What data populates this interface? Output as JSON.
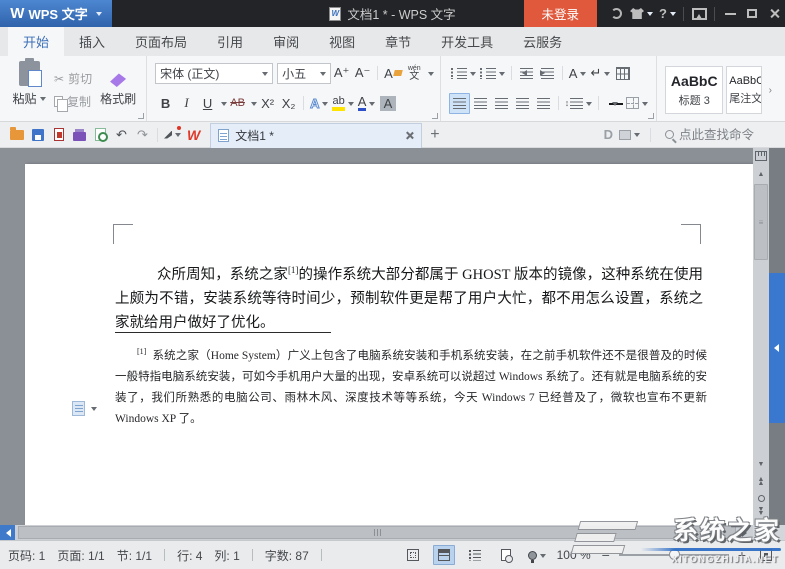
{
  "titlebar": {
    "app_button_label": "WPS 文字",
    "doc_title": "文档1 * - WPS 文字",
    "login_label": "未登录"
  },
  "menu_tabs": [
    {
      "label": "开始"
    },
    {
      "label": "插入"
    },
    {
      "label": "页面布局"
    },
    {
      "label": "引用"
    },
    {
      "label": "审阅"
    },
    {
      "label": "视图"
    },
    {
      "label": "章节"
    },
    {
      "label": "开发工具"
    },
    {
      "label": "云服务"
    }
  ],
  "ribbon": {
    "paste_label": "粘贴",
    "cut_label": "剪切",
    "copy_label": "复制",
    "format_painter_label": "格式刷",
    "font_name": "宋体 (正文)",
    "font_size": "小五",
    "grow_font": "A⁺",
    "shrink_font": "A⁻",
    "clear_a": "A",
    "phonetic_top": "wén",
    "phonetic_bottom": "文",
    "bold": "B",
    "italic": "I",
    "underline": "U",
    "strike": "AB",
    "superscript": "X²",
    "subscript": "X₂",
    "outline_a": "A",
    "highlight_ab": "ab",
    "color_a": "A",
    "shade_a": "A",
    "char_scale": "A",
    "return_glyph": "↵",
    "styles": [
      {
        "preview": "AaBbC",
        "label": "标题 3"
      },
      {
        "preview": "AaBbC",
        "label": "尾注文"
      }
    ]
  },
  "glyphs": {
    "wps_w": "W",
    "wps_w_small": "W",
    "question": "?",
    "scissors": "✂",
    "undo": "↶",
    "redo": "↷",
    "docer_d": "D",
    "style_arrow": "›",
    "up_arrow": "▲",
    "down_arrow": "▼",
    "grip": "≡",
    "updown_arrow": "↕"
  },
  "doc_tabs": {
    "active_tab": "文档1 *",
    "search_placeholder": "点此查找命令"
  },
  "document": {
    "para_before_ref": "众所周知，系统之家",
    "para_ref": "[1]",
    "para_after_ref": "的操作系统大部分都属于 GHOST 版本的镜像，这种系统在使用上颇为不错，安装系统等待时间少，预制软件更是帮了用户大忙，都不用怎么设置，系统之家就给用户做好了优化。",
    "footnote_ref": "[1]",
    "footnote_text": "系统之家（Home System）广义上包含了电脑系统安装和手机系统安装，在之前手机软件还不是很普及的时候一般特指电脑系统安装，可如今手机用户大量的出现，安卓系统可以说超过 Windows 系统了。还有就是电脑系统的安装了，我们所熟悉的电脑公司、雨林木风、深度技术等等系统，今天 Windows 7 已经普及了，微软也宣布不更新 Windows XP 了。"
  },
  "status_bar": {
    "page_number": "页码: 1",
    "pages": "页面: 1/1",
    "section": "节: 1/1",
    "line": "行: 4",
    "column": "列: 1",
    "word_count": "字数: 87",
    "zoom_level": "100 %"
  },
  "watermark": {
    "title": "系统之家",
    "subtitle": "XITONGZHIJIA.NET"
  },
  "colors": {
    "wps_blue": "#3d70b8",
    "login_orange": "#e0593c",
    "titlebar_bg": "#232427",
    "doc_bg": "#8b9096",
    "highlight_yellow": "#ffe400",
    "font_color_blue": "#2d50c8"
  }
}
